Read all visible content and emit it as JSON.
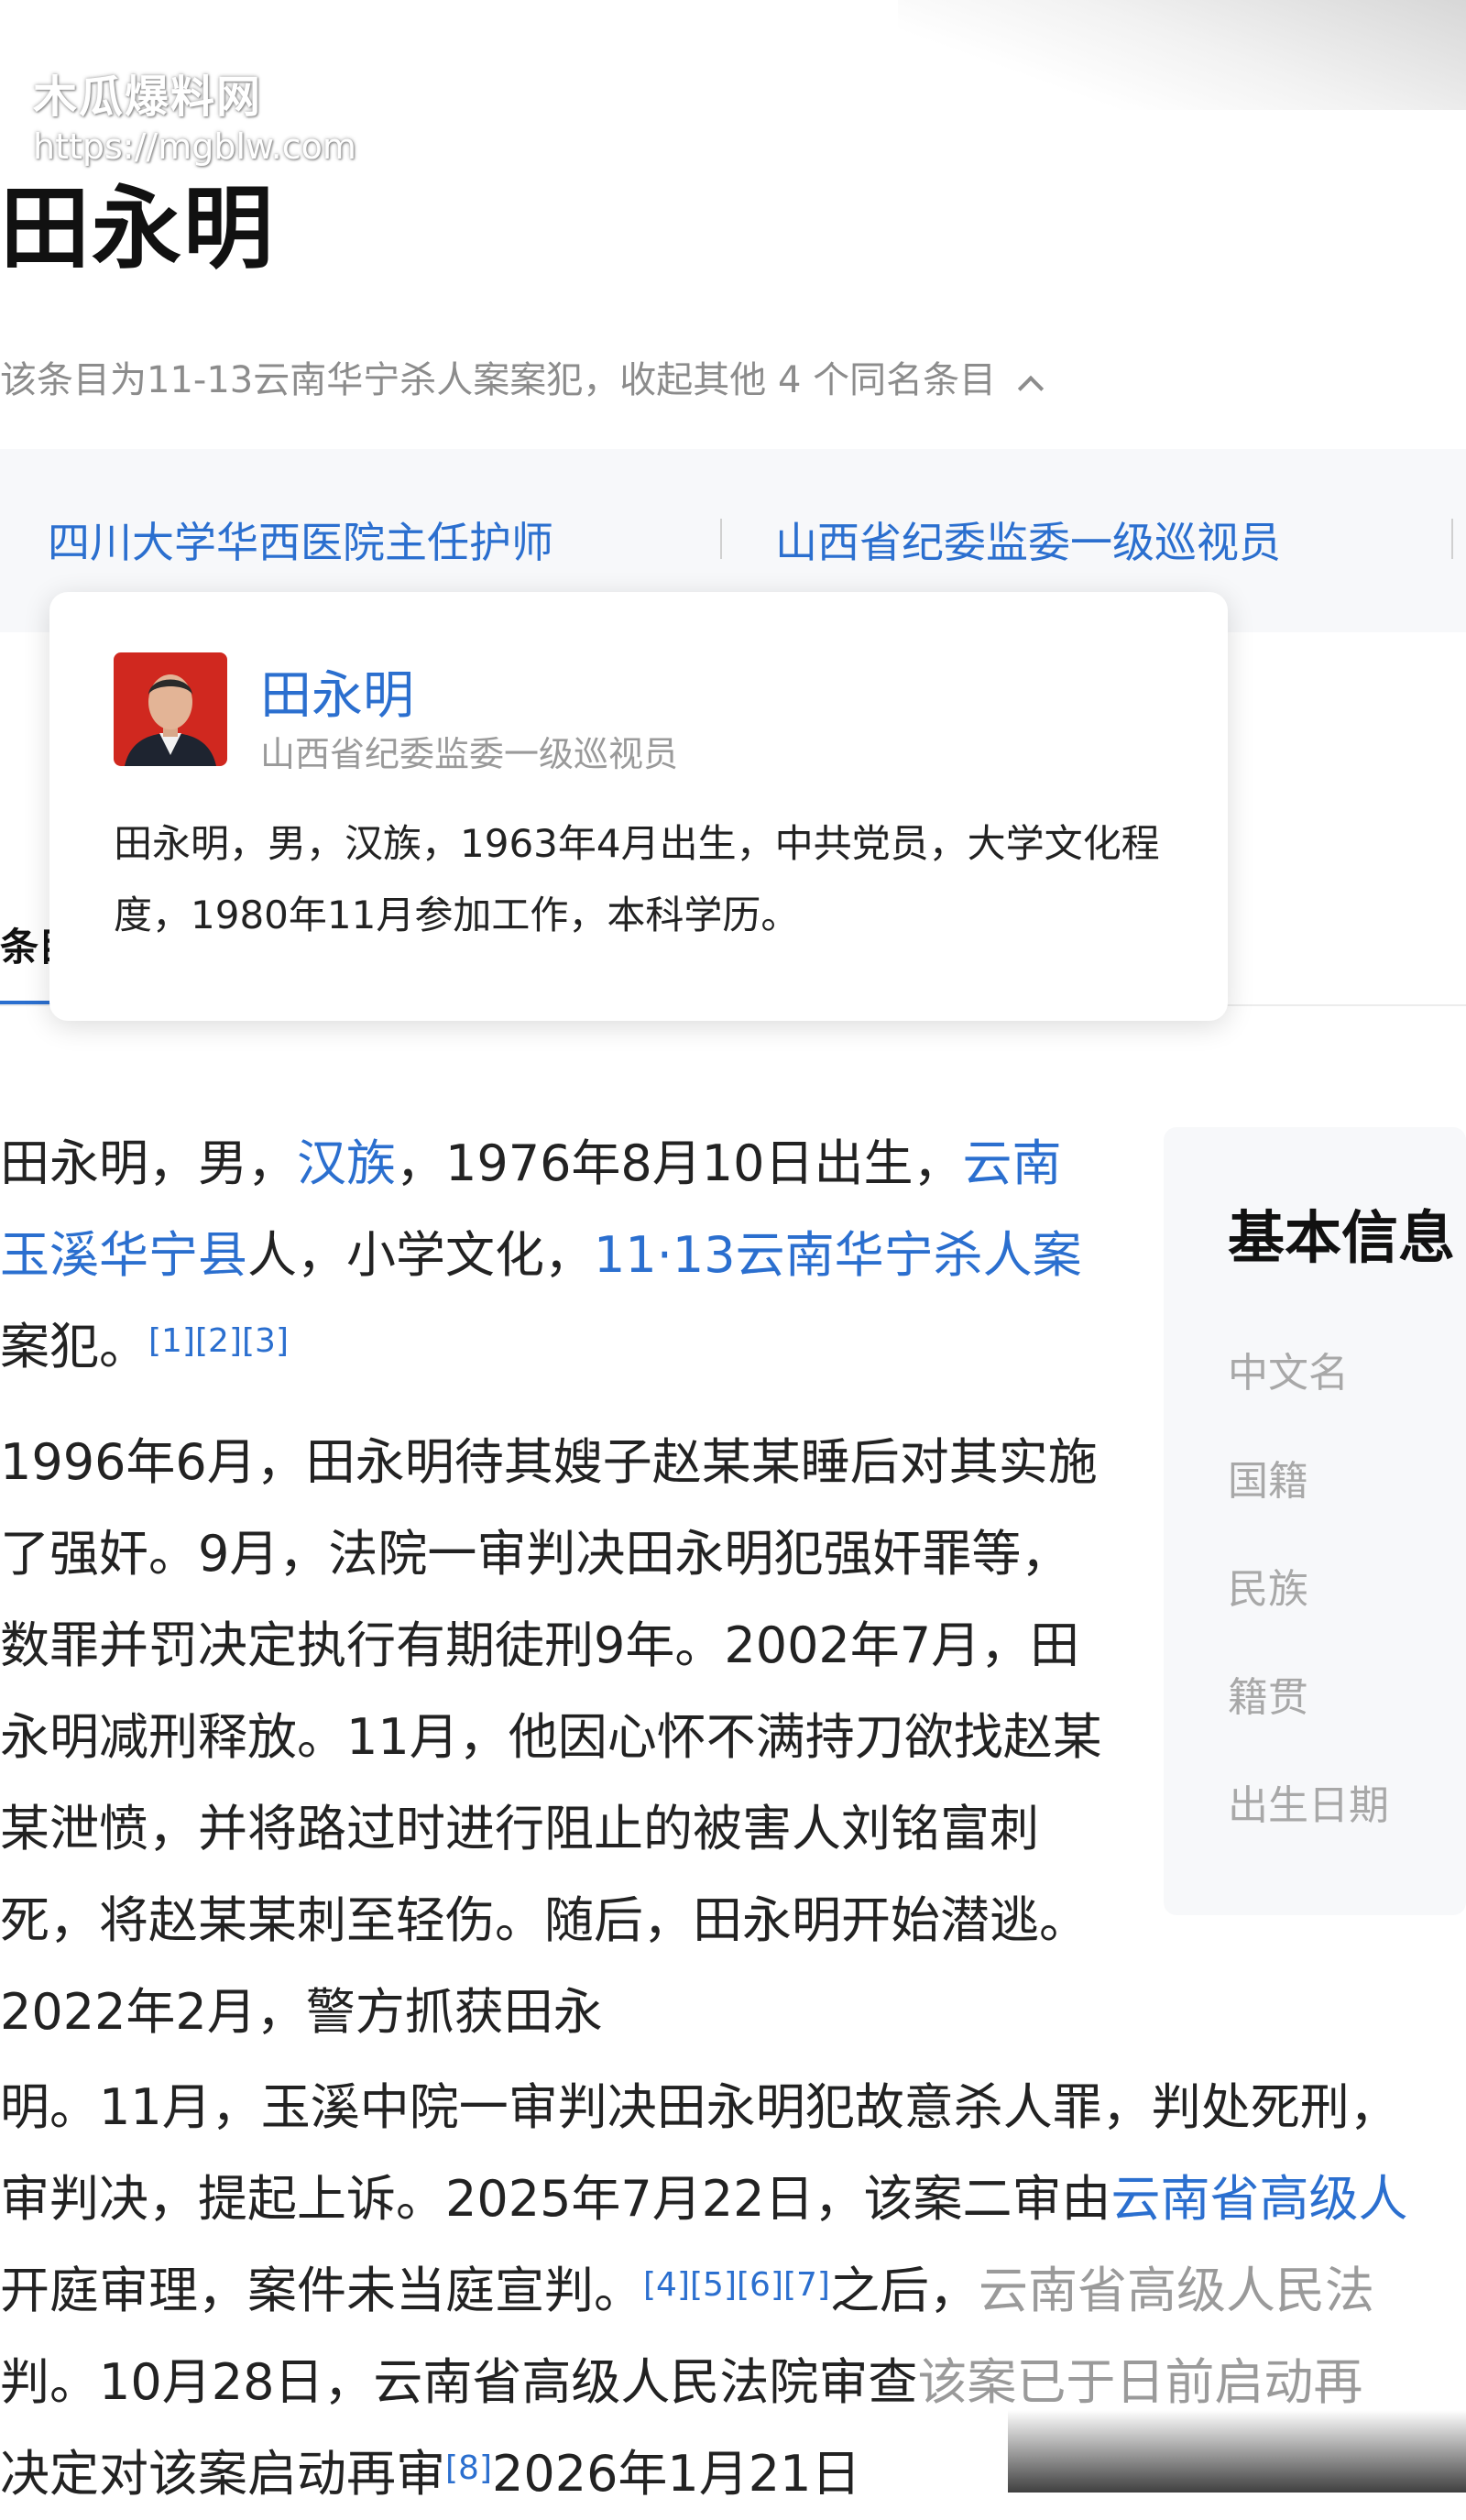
{
  "watermark": {
    "site_name": "木瓜爆料网",
    "url": "https://mgblw.com"
  },
  "header": {
    "title": "田永明",
    "disambiguation": "该条目为11-13云南华宁杀人案案犯，收起其他 4 个同名条目"
  },
  "same_name_tabs": [
    {
      "label": "四川大学华西医院主任护师"
    },
    {
      "label": "山西省纪委监委一级巡视员"
    }
  ],
  "popup": {
    "name": "田永明",
    "subtitle": "山西省纪委监委一级巡视员",
    "description": "田永明，男，汉族，1963年4月出生，中共党员，大学文化程度，1980年11月参加工作，本科学历。"
  },
  "content_tab": {
    "label": "条目"
  },
  "intro": {
    "t1": "田永明，男，",
    "link_ethnicity": "汉族",
    "t2": "，1976年8月10日出生，",
    "link_hometown": "云南玉溪华宁县",
    "t3": "人，小学文化，",
    "link_case": "11·13云南华宁杀人案",
    "t4": "案犯。",
    "refs": "[1][2][3]"
  },
  "paragraph2": {
    "text": "1996年6月，田永明待其嫂子赵某某睡后对其实施了强奸。9月，法院一审判决田永明犯强奸罪等，数罪并罚决定执行有期徒刑9年。2002年7月，田永明减刑释放。11月，他因心怀不满持刀欲找赵某某泄愤，并将路过时进行阻止的被害人刘铭富刺死，将赵某某刺至轻伤。随后，田永明开始潜逃。2022年2月，警方抓获田永",
    "line1": "明。11月，玉溪中院一审判决田永明犯故意杀人罪，判处死刑，",
    "line2_a": "审判决，提起上诉。2025年7月22日，该案二审由",
    "line2_link": "云南省高级人",
    "line3_a": "开庭审理，案件未当庭宣判。",
    "line3_refs": "[4][5][6][7]",
    "line3_b": "之后，",
    "line3_garbled": "云南省高级人民法",
    "line4_a": "判。10月28日，云南省高级人民法院审查",
    "line4_garbled": "该案已于日前启动再",
    "line5_a": "决定对该案启动再审",
    "line5_ref": "[8]",
    "line5_b": "2026年1月21日"
  },
  "infobox": {
    "title": "基本信息",
    "labels": [
      "中文名",
      "国籍",
      "民族",
      "籍贯",
      "出生日期"
    ]
  },
  "colors": {
    "link": "#2b6fcf",
    "muted": "#8c8c8c",
    "panel_bg": "#f7f8fa"
  }
}
